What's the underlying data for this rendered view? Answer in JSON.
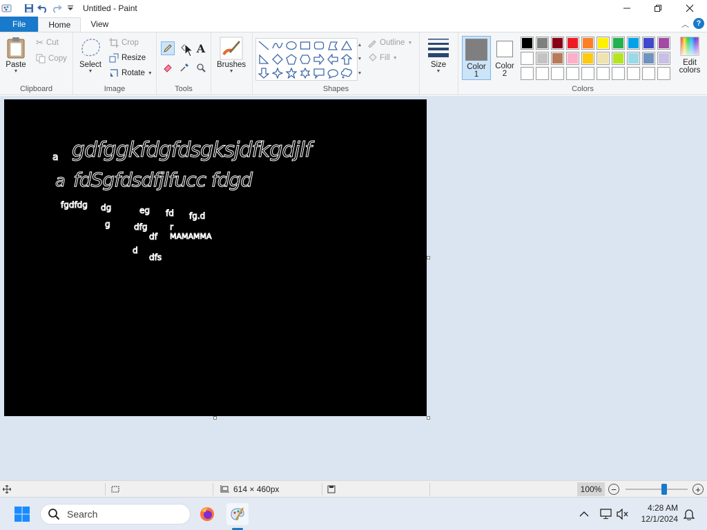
{
  "window": {
    "title": "Untitled - Paint"
  },
  "tabs": {
    "file": "File",
    "home": "Home",
    "view": "View"
  },
  "help": {
    "label": "?"
  },
  "clipboard": {
    "group_label": "Clipboard",
    "paste": "Paste",
    "cut": "Cut",
    "copy": "Copy"
  },
  "image_group": {
    "group_label": "Image",
    "select": "Select",
    "crop": "Crop",
    "resize": "Resize",
    "rotate": "Rotate"
  },
  "tools": {
    "group_label": "Tools",
    "text_tool": "A"
  },
  "brushes": {
    "label": "Brushes"
  },
  "shapes": {
    "group_label": "Shapes",
    "outline": "Outline",
    "fill": "Fill"
  },
  "size": {
    "label": "Size"
  },
  "colors": {
    "group_label": "Colors",
    "color1_label": "Color\n1",
    "color1_a": "Color",
    "color1_b": "1",
    "color2_a": "Color",
    "color2_b": "2",
    "color1_value": "#7f7f7f",
    "color2_value": "#ffffff",
    "edit_a": "Edit",
    "edit_b": "colors",
    "palette_row1": [
      "#000000",
      "#7f7f7f",
      "#880015",
      "#ed1c24",
      "#ff7f27",
      "#fff200",
      "#22b14c",
      "#00a2e8",
      "#3f48cc",
      "#a349a4"
    ],
    "palette_row2": [
      "#ffffff",
      "#c3c3c3",
      "#b97a57",
      "#ffaec9",
      "#ffc90e",
      "#efe4b0",
      "#b5e61d",
      "#99d9ea",
      "#7092be",
      "#c8bfe7"
    ],
    "palette_row3": [
      "#ffffff",
      "#ffffff",
      "#ffffff",
      "#ffffff",
      "#ffffff",
      "#ffffff",
      "#ffffff",
      "#ffffff",
      "#ffffff",
      "#ffffff"
    ]
  },
  "canvas_text": {
    "line1_small": "a",
    "line1": "gdfggkfdgfdsgksjdfkgdjlf",
    "line2_small": "a",
    "line2": "fdSgfdsdfjlfucc  fdgd",
    "w1": "fgdfdg",
    "w2": "dg",
    "w3": "eg",
    "w4": "fd",
    "w5": "fg.d",
    "w6": "g",
    "w7": "dfg",
    "w8": "df",
    "w9": "r",
    "w10": "MAMAMMA",
    "w11": "d",
    "w12": "dfs"
  },
  "status": {
    "dimensions": "614 × 460px",
    "zoom": "100%",
    "zoom_fraction": 0.62
  },
  "taskbar": {
    "search_placeholder": "Search",
    "time": "4:28 AM",
    "date": "12/1/2024"
  }
}
